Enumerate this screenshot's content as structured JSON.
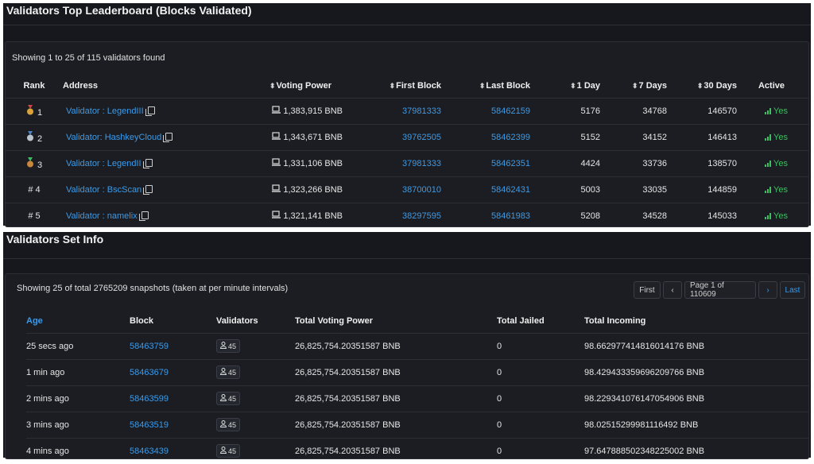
{
  "leaderboard": {
    "title": "Validators Top Leaderboard (Blocks Validated)",
    "summary": "Showing 1 to 25 of 115 validators found",
    "columns": {
      "rank": "Rank",
      "address": "Address",
      "voting_power": "Voting Power",
      "first_block": "First Block",
      "last_block": "Last Block",
      "day1": "1 Day",
      "days7": "7 Days",
      "days30": "30 Days",
      "active": "Active"
    },
    "medal_colors": {
      "gold": "#d9a33a",
      "silver": "#b9c3cc",
      "bronze": "#c9863d",
      "ribbon_red": "#d04545",
      "ribbon_blue": "#4a86c8",
      "ribbon_green": "#3fbf62"
    },
    "rows": [
      {
        "rank": "1",
        "medal": "gold",
        "address": "Validator : LegendIII",
        "voting_power": "1,383,915 BNB",
        "first_block": "37981333",
        "last_block": "58462159",
        "day1": "5176",
        "days7": "34768",
        "days30": "146570",
        "active": "Yes"
      },
      {
        "rank": "2",
        "medal": "silver",
        "address": "Validator: HashkeyCloud",
        "voting_power": "1,343,671 BNB",
        "first_block": "39762505",
        "last_block": "58462399",
        "day1": "5152",
        "days7": "34152",
        "days30": "146413",
        "active": "Yes"
      },
      {
        "rank": "3",
        "medal": "bronze",
        "address": "Validator : LegendII",
        "voting_power": "1,331,106 BNB",
        "first_block": "37981333",
        "last_block": "58462351",
        "day1": "4424",
        "days7": "33736",
        "days30": "138570",
        "active": "Yes"
      },
      {
        "rank": "# 4",
        "medal": "",
        "address": "Validator : BscScan",
        "voting_power": "1,323,266 BNB",
        "first_block": "38700010",
        "last_block": "58462431",
        "day1": "5003",
        "days7": "33035",
        "days30": "144859",
        "active": "Yes"
      },
      {
        "rank": "# 5",
        "medal": "",
        "address": "Validator : namelix",
        "voting_power": "1,321,141 BNB",
        "first_block": "38297595",
        "last_block": "58461983",
        "day1": "5208",
        "days7": "34528",
        "days30": "145033",
        "active": "Yes"
      }
    ]
  },
  "setinfo": {
    "title": "Validators Set Info",
    "summary": "Showing 25 of total 2765209 snapshots (taken at per minute intervals)",
    "pager": {
      "first": "First",
      "prev": "‹",
      "page": "Page 1 of 110609",
      "next": "›",
      "last": "Last"
    },
    "columns": {
      "age": "Age",
      "block": "Block",
      "validators": "Validators",
      "total_voting_power": "Total Voting Power",
      "total_jailed": "Total Jailed",
      "total_incoming": "Total Incoming"
    },
    "rows": [
      {
        "age": "25 secs ago",
        "block": "58463759",
        "validators": "45",
        "total_voting_power": "26,825,754.20351587 BNB",
        "total_jailed": "0",
        "total_incoming": "98.662977414816014176 BNB"
      },
      {
        "age": "1 min ago",
        "block": "58463679",
        "validators": "45",
        "total_voting_power": "26,825,754.20351587 BNB",
        "total_jailed": "0",
        "total_incoming": "98.429433359696209766 BNB"
      },
      {
        "age": "2 mins ago",
        "block": "58463599",
        "validators": "45",
        "total_voting_power": "26,825,754.20351587 BNB",
        "total_jailed": "0",
        "total_incoming": "98.229341076147054906 BNB"
      },
      {
        "age": "3 mins ago",
        "block": "58463519",
        "validators": "45",
        "total_voting_power": "26,825,754.20351587 BNB",
        "total_jailed": "0",
        "total_incoming": "98.02515299981116492 BNB"
      },
      {
        "age": "4 mins ago",
        "block": "58463439",
        "validators": "45",
        "total_voting_power": "26,825,754.20351587 BNB",
        "total_jailed": "0",
        "total_incoming": "97.647888502348225002 BNB"
      }
    ]
  }
}
